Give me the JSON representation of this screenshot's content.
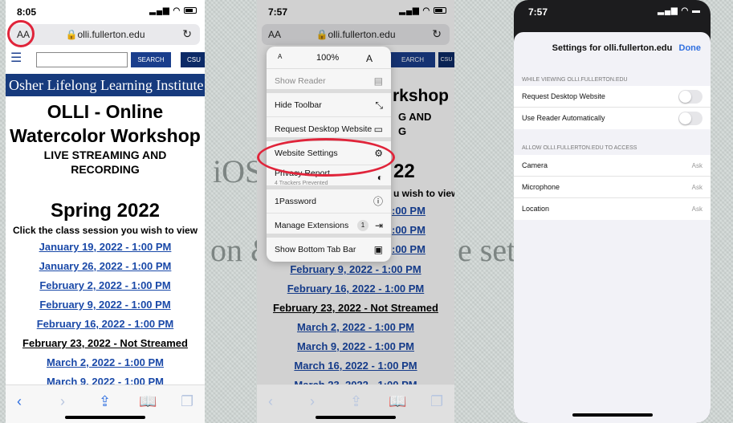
{
  "background": {
    "line1_fragment": "iOS",
    "line2_left": "on &",
    "line2_right": "e sett"
  },
  "screen1": {
    "status": {
      "time": "8:05"
    },
    "url": {
      "aa": "AA",
      "host": "olli.fullerton.edu"
    },
    "search_button": "SEARCH",
    "csu_label": "CSU",
    "banner": "Osher Lifelong Learning Institute",
    "title_line1": "OLLI - Online",
    "title_line2": "Watercolor Workshop",
    "subtitle_line1": "LIVE STREAMING AND",
    "subtitle_line2": "RECORDING",
    "term": "Spring 2022",
    "instructions": "Click the class session you wish to view",
    "sessions": [
      "January 19, 2022 - 1:00 PM",
      "January 26, 2022 - 1:00 PM",
      "February 2, 2022 - 1:00 PM",
      "February 9, 2022 - 1:00 PM",
      "February 16, 2022 - 1:00 PM",
      "February 23, 2022 - Not Streamed",
      "March 2, 2022 - 1:00 PM",
      "March 9, 2022 - 1:00 PM"
    ]
  },
  "screen2": {
    "status": {
      "time": "7:57"
    },
    "url": {
      "aa": "AA",
      "host": "olli.fullerton.edu"
    },
    "menu": {
      "zoom_small": "A",
      "zoom_level": "100%",
      "zoom_large": "A",
      "show_reader": "Show Reader",
      "hide_toolbar": "Hide Toolbar",
      "request_desktop": "Request Desktop Website",
      "website_settings": "Website Settings",
      "privacy_report": "Privacy Report",
      "privacy_sub": "4 Trackers Prevented",
      "onepassword": "1Password",
      "manage_extensions": "Manage Extensions",
      "extensions_count": "1",
      "show_bottom_tab_bar": "Show Bottom Tab Bar"
    },
    "visible_text": {
      "frag_rkshop": "rkshop",
      "frag_gand": "G AND",
      "frag_g": "G",
      "frag_22": "22",
      "frag_wish": "u wish to view",
      "frag_time1": ":00 PM",
      "frag_time2": ":00 PM",
      "frag_time3": ":00 PM",
      "frag_time4": ":00 PM",
      "frag_search": "EARCH",
      "frag_csu": "CSU"
    },
    "sessions": [
      "February 9, 2022 - 1:00 PM",
      "February 16, 2022 - 1:00 PM",
      "February 23, 2022 - Not Streamed",
      "March 2, 2022 - 1:00 PM",
      "March 9, 2022 - 1:00 PM",
      "March 16, 2022 - 1:00 PM",
      "March 23, 2022 - 1:00 PM"
    ]
  },
  "screen3": {
    "status": {
      "time": "7:57"
    },
    "title": "Settings for olli.fullerton.edu",
    "done": "Done",
    "section1_header": "WHILE VIEWING OLLI.FULLERTON.EDU",
    "request_desktop": "Request Desktop Website",
    "use_reader": "Use Reader Automatically",
    "section2_header": "ALLOW OLLI.FULLERTON.EDU TO ACCESS",
    "camera": "Camera",
    "microphone": "Microphone",
    "location": "Location",
    "ask": "Ask"
  },
  "icons": {
    "back": "chevron-left",
    "forward": "chevron-right",
    "share": "share",
    "bookmarks": "book",
    "tabs": "tabs"
  }
}
